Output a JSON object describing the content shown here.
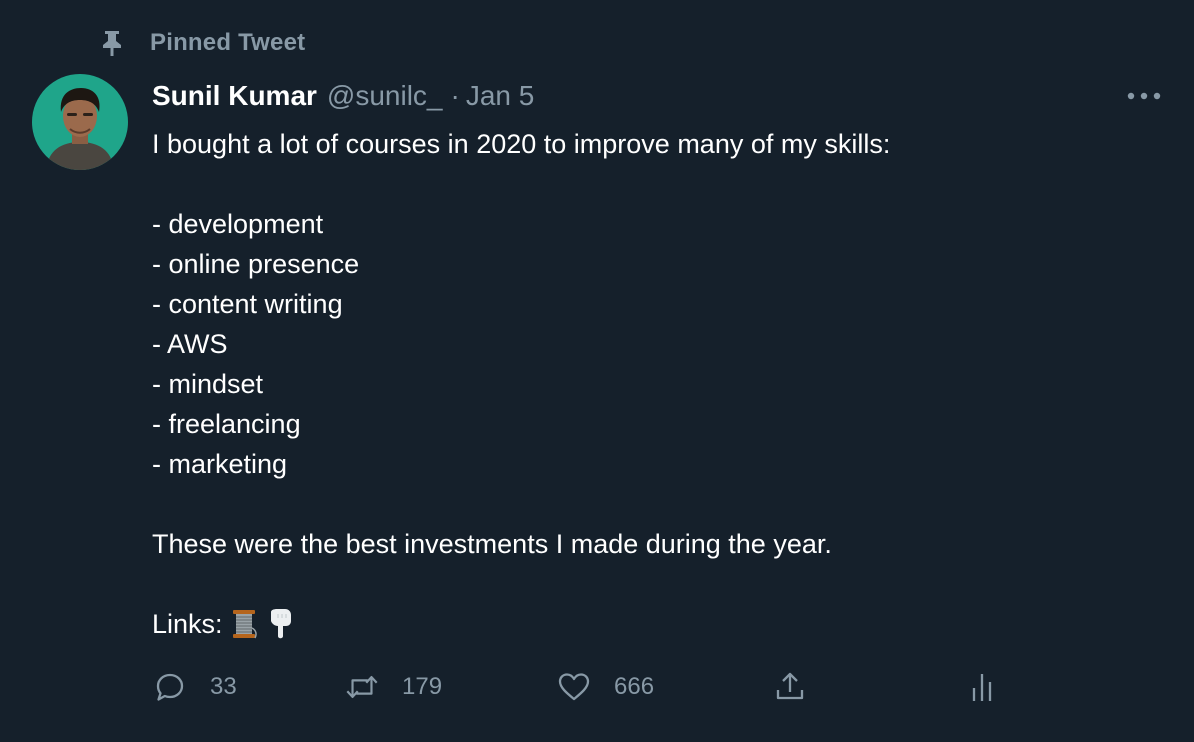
{
  "pinned": {
    "label": "Pinned Tweet",
    "icon": "pin-icon"
  },
  "author": {
    "name": "Sunil Kumar",
    "handle": "@sunilc_",
    "separator": "·",
    "date": "Jan 5",
    "avatar_bg": "#1fa58a"
  },
  "tweet": {
    "intro": "I bought a lot of courses in 2020 to improve many of my skills:",
    "items": [
      "- development",
      "- online presence",
      "- content writing",
      "- AWS",
      "- mindset",
      "- freelancing",
      "- marketing"
    ],
    "closing": "These were the best investments I made during the year.",
    "links_label": "Links:",
    "link_icons": [
      "thread-spool-icon",
      "pointing-down-icon"
    ]
  },
  "actions": {
    "reply_count": "33",
    "retweet_count": "179",
    "like_count": "666"
  },
  "colors": {
    "background": "#15202b",
    "text": "#ffffff",
    "muted": "#8899a6"
  }
}
